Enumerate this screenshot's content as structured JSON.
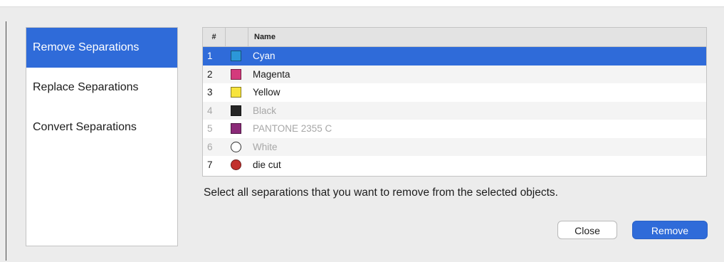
{
  "sidebar": {
    "items": [
      {
        "label": "Remove Separations",
        "active": true
      },
      {
        "label": "Replace Separations",
        "active": false
      },
      {
        "label": "Convert Separations",
        "active": false
      }
    ]
  },
  "table": {
    "headers": {
      "number": "#",
      "swatch": "",
      "name": "Name"
    },
    "rows": [
      {
        "number": "1",
        "name": "Cyan",
        "color": "#2b97d8",
        "shape": "square",
        "state": "selected"
      },
      {
        "number": "2",
        "name": "Magenta",
        "color": "#d43a7c",
        "shape": "square",
        "state": "normal"
      },
      {
        "number": "3",
        "name": "Yellow",
        "color": "#f7e43d",
        "shape": "square",
        "state": "normal"
      },
      {
        "number": "4",
        "name": "Black",
        "color": "#262626",
        "shape": "square",
        "state": "disabled"
      },
      {
        "number": "5",
        "name": "PANTONE 2355 C",
        "color": "#8b2a78",
        "shape": "square",
        "state": "disabled"
      },
      {
        "number": "6",
        "name": "White",
        "color": "#ffffff",
        "shape": "circle-outline",
        "state": "disabled"
      },
      {
        "number": "7",
        "name": "die cut",
        "color": "#c2302c",
        "shape": "circle",
        "state": "normal"
      }
    ]
  },
  "hint_text": "Select all separations that you want to remove from the selected objects.",
  "buttons": {
    "close": "Close",
    "remove": "Remove"
  },
  "colors": {
    "accent": "#2f6bd9"
  }
}
